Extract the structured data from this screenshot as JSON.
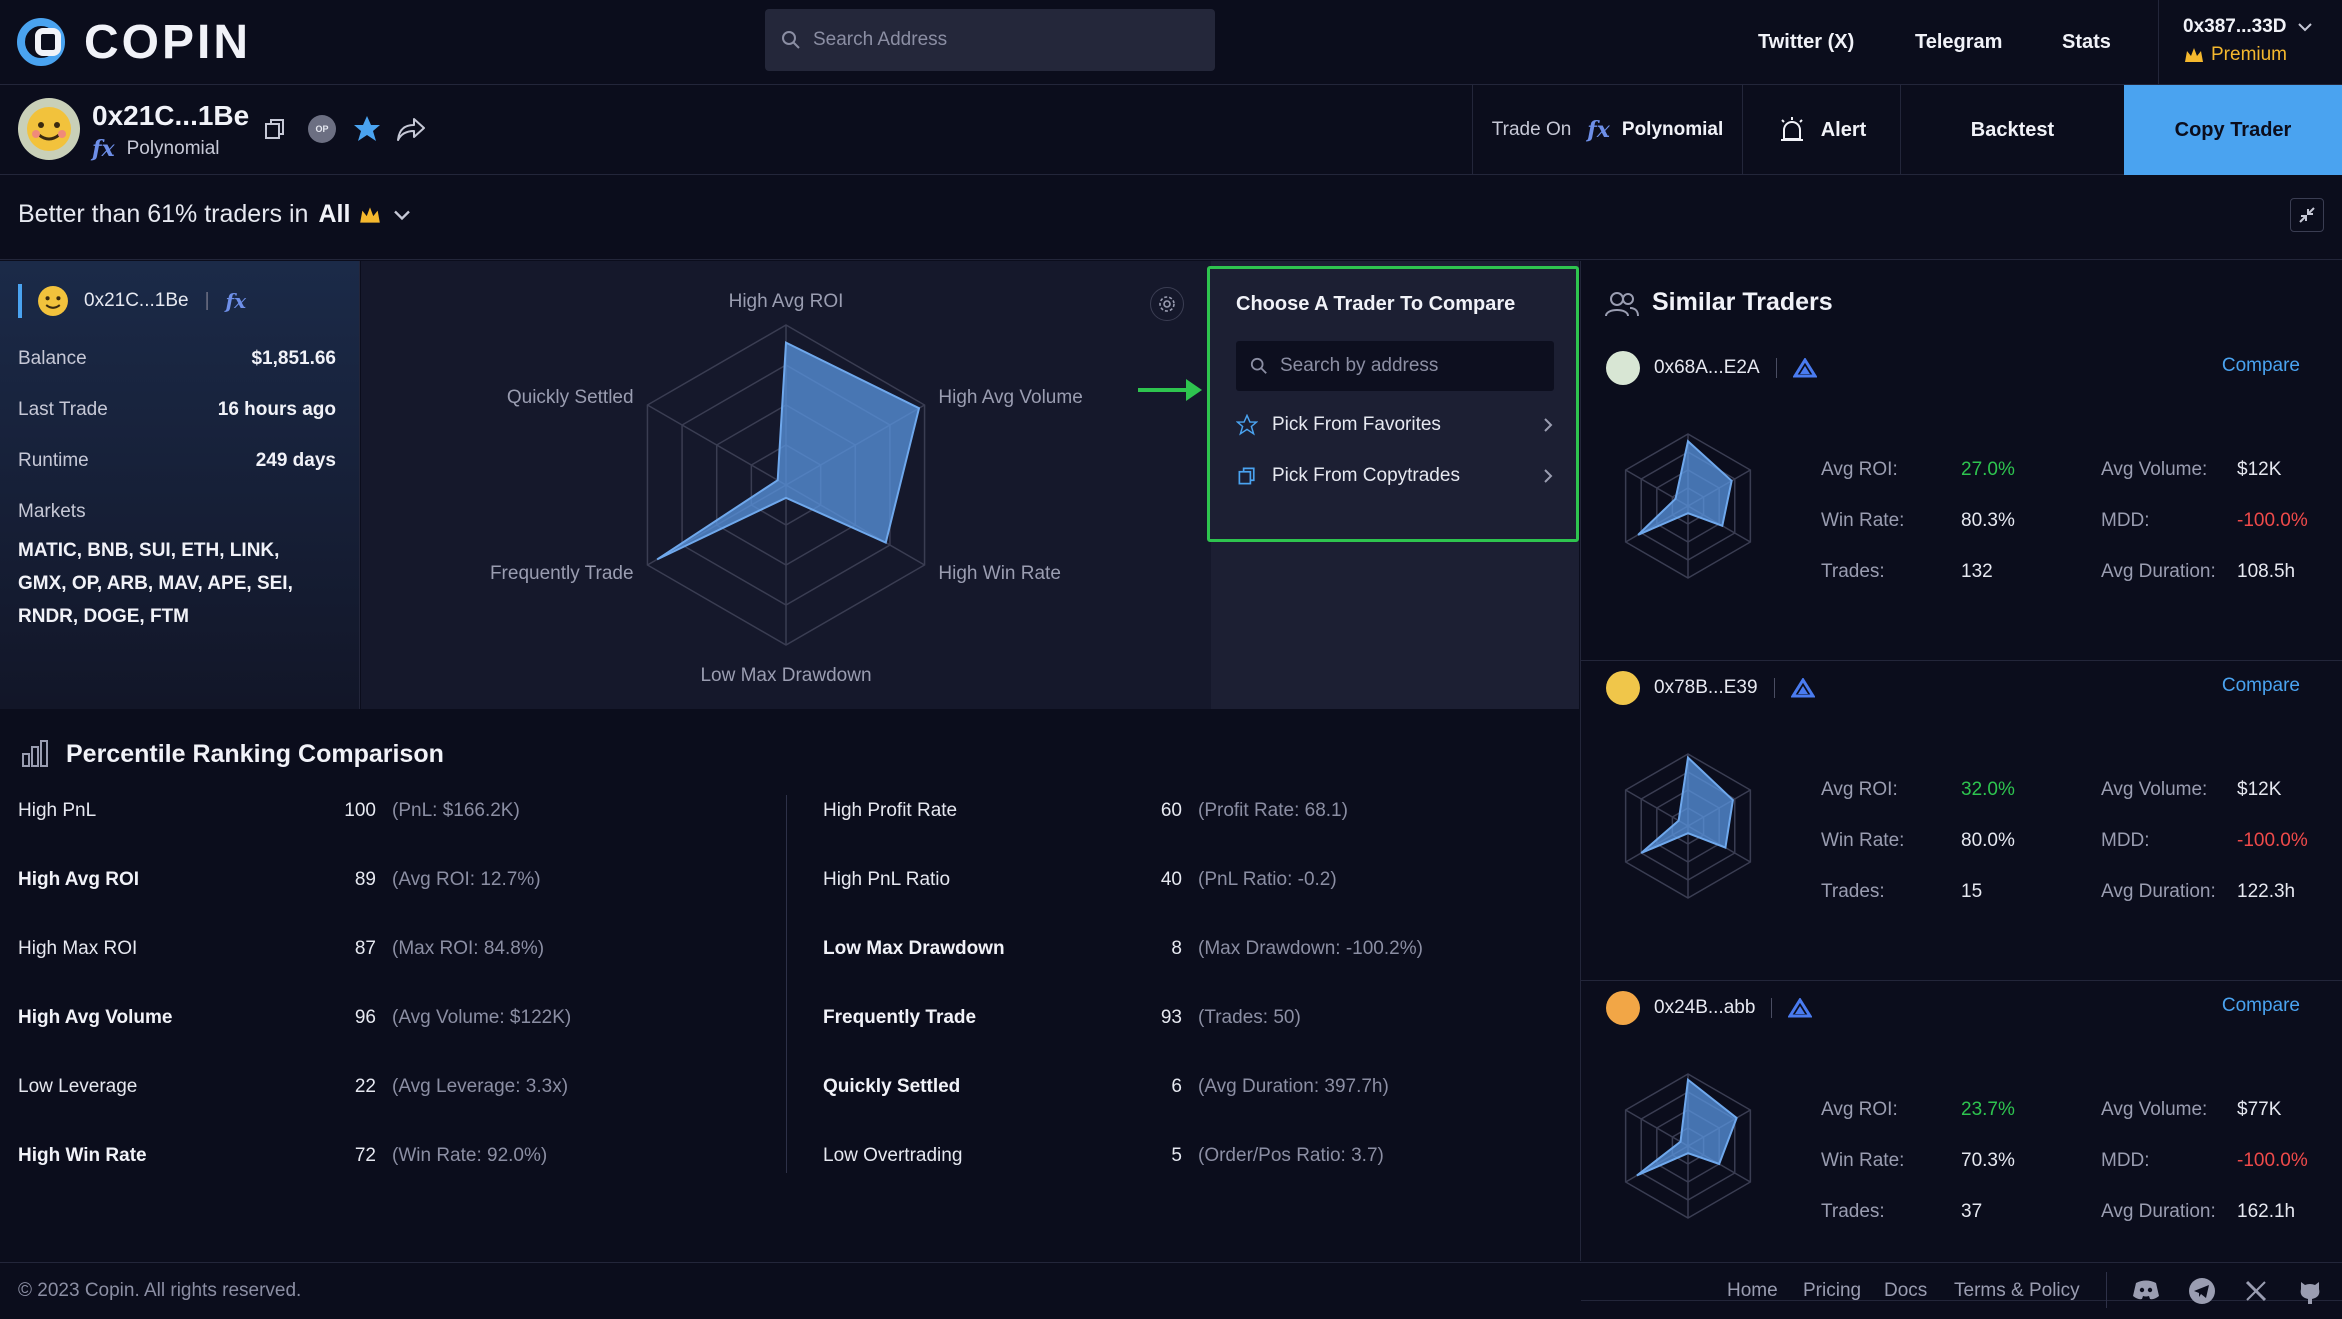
{
  "brand": {
    "logo_text": "COPIN"
  },
  "search": {
    "placeholder": "Search Address"
  },
  "nav": {
    "twitter": "Twitter (X)",
    "telegram": "Telegram",
    "stats": "Stats"
  },
  "account": {
    "address": "0x387...33D",
    "tier": "Premium"
  },
  "trader": {
    "address": "0x21C...1Be",
    "protocol": "Polynomial",
    "trade_on_label": "Trade On",
    "trade_on_protocol": "Polynomial",
    "op_badge": "OP",
    "alert_label": "Alert",
    "backtest_label": "Backtest",
    "copy_label": "Copy Trader"
  },
  "rank": {
    "prefix": "Better than 61% traders in",
    "scope": "All"
  },
  "info": {
    "address": "0x21C...1Be",
    "separator": "|",
    "balance_label": "Balance",
    "balance": "$1,851.66",
    "last_trade_label": "Last Trade",
    "last_trade": "16 hours ago",
    "runtime_label": "Runtime",
    "runtime": "249 days",
    "markets_label": "Markets",
    "markets_line1": "MATIC, BNB, SUI, ETH, LINK,",
    "markets_line2": "GMX, OP, ARB, MAV, APE, SEI,",
    "markets_line3": "RNDR, DOGE, FTM"
  },
  "radar": {
    "axes": [
      "High Avg ROI",
      "High Avg Volume",
      "High Win Rate",
      "Low Max Drawdown",
      "Frequently Trade",
      "Quickly Settled"
    ],
    "values": [
      89,
      96,
      72,
      8,
      93,
      6
    ]
  },
  "compare": {
    "title": "Choose A Trader To Compare",
    "search_placeholder": "Search by address",
    "favorites": "Pick From Favorites",
    "copytrades": "Pick From Copytrades"
  },
  "similar": {
    "title": "Similar Traders",
    "compare_label": "Compare",
    "labels": {
      "roi": "Avg ROI:",
      "volume": "Avg Volume:",
      "winrate": "Win Rate:",
      "mdd": "MDD:",
      "trades": "Trades:",
      "duration": "Avg Duration:"
    },
    "colors": {
      "positive": "#2ec44f",
      "negative": "#ef4a4a"
    },
    "traders": [
      {
        "address": "0x68A...E2A",
        "roi": "27.0%",
        "volume": "$12K",
        "winrate": "80.3%",
        "mdd": "-100.0%",
        "trades": "132",
        "duration": "108.5h",
        "avatar": "#d8e6d4",
        "radar": [
          90,
          70,
          55,
          10,
          80,
          20
        ]
      },
      {
        "address": "0x78B...E39",
        "roi": "32.0%",
        "volume": "$12K",
        "winrate": "80.0%",
        "mdd": "-100.0%",
        "trades": "15",
        "duration": "122.3h",
        "avatar": "#f0c64a",
        "radar": [
          95,
          72,
          60,
          10,
          75,
          15
        ]
      },
      {
        "address": "0x24B...abb",
        "roi": "23.7%",
        "volume": "$77K",
        "winrate": "70.3%",
        "mdd": "-100.0%",
        "trades": "37",
        "duration": "162.1h",
        "avatar": "#f2a646",
        "radar": [
          92,
          78,
          50,
          10,
          82,
          12
        ]
      }
    ]
  },
  "percentile": {
    "title": "Percentile Ranking Comparison",
    "left": [
      {
        "name": "High PnL",
        "score": "100",
        "detail": "(PnL: $166.2K)",
        "bold": false
      },
      {
        "name": "High Avg ROI",
        "score": "89",
        "detail": "(Avg ROI: 12.7%)",
        "bold": true
      },
      {
        "name": "High Max ROI",
        "score": "87",
        "detail": "(Max ROI: 84.8%)",
        "bold": false
      },
      {
        "name": "High Avg Volume",
        "score": "96",
        "detail": "(Avg Volume: $122K)",
        "bold": true
      },
      {
        "name": "Low Leverage",
        "score": "22",
        "detail": "(Avg Leverage: 3.3x)",
        "bold": false
      },
      {
        "name": "High Win Rate",
        "score": "72",
        "detail": "(Win Rate: 92.0%)",
        "bold": true
      }
    ],
    "right": [
      {
        "name": "High Profit Rate",
        "score": "60",
        "detail": "(Profit Rate: 68.1)",
        "bold": false
      },
      {
        "name": "High PnL Ratio",
        "score": "40",
        "detail": "(PnL Ratio: -0.2)",
        "bold": false
      },
      {
        "name": "Low Max Drawdown",
        "score": "8",
        "detail": "(Max Drawdown: -100.2%)",
        "bold": true
      },
      {
        "name": "Frequently Trade",
        "score": "93",
        "detail": "(Trades: 50)",
        "bold": true
      },
      {
        "name": "Quickly Settled",
        "score": "6",
        "detail": "(Avg Duration: 397.7h)",
        "bold": true
      },
      {
        "name": "Low Overtrading",
        "score": "5",
        "detail": "(Order/Pos Ratio: 3.7)",
        "bold": false
      }
    ]
  },
  "footer": {
    "copyright": "© 2023 Copin. All rights reserved.",
    "links": [
      "Home",
      "Pricing",
      "Docs",
      "Terms & Policy"
    ]
  },
  "theme": {
    "accent": "#4aa3f0",
    "highlight": "#2ec44f",
    "premium": "#f5b82e"
  }
}
